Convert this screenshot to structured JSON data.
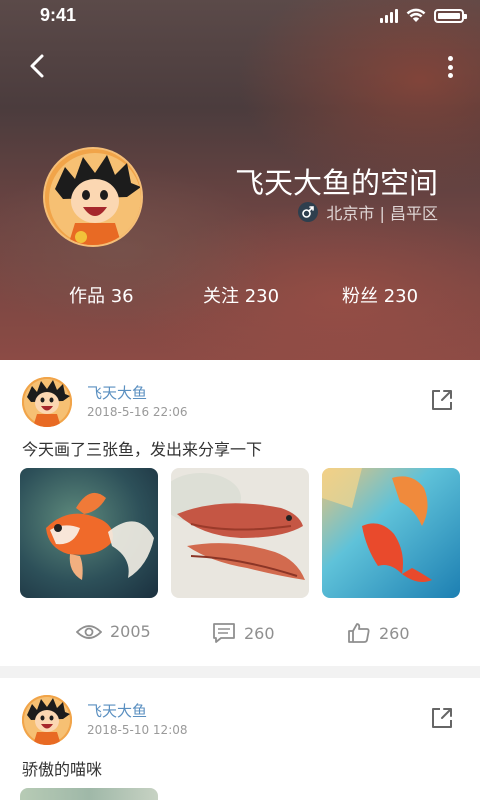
{
  "status_bar": {
    "time": "9:41"
  },
  "profile": {
    "space_title": "飞天大鱼的空间",
    "location": "北京市 | 昌平区",
    "stats": [
      {
        "label": "作品 36"
      },
      {
        "label": "关注 230"
      },
      {
        "label": "粉丝 230"
      }
    ]
  },
  "posts": [
    {
      "author": "飞天大鱼",
      "date": "2018-5-16  22:06",
      "text": "今天画了三张鱼，发出来分享一下",
      "views": "2005",
      "comments": "260",
      "likes": "260"
    },
    {
      "author": "飞天大鱼",
      "date": "2018-5-10  12:08",
      "text": "骄傲的喵咪"
    }
  ],
  "colors": {
    "link": "#5a8fc0",
    "muted": "#9a9a9a",
    "header": "#5b4a49"
  },
  "icons": [
    "back-icon",
    "more-icon",
    "male-icon",
    "share-icon",
    "eye-icon",
    "comment-icon",
    "thumbs-up-icon",
    "wifi-icon",
    "signal-icon",
    "battery-icon"
  ]
}
